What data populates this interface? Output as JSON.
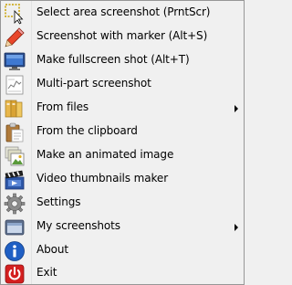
{
  "menu": {
    "items": [
      {
        "label": "Select area screenshot (PrntScr)",
        "icon": "select-area-icon",
        "submenu": false
      },
      {
        "label": "Screenshot with marker (Alt+S)",
        "icon": "pencil-icon",
        "submenu": false
      },
      {
        "label": "Make fullscreen shot (Alt+T)",
        "icon": "monitor-icon",
        "submenu": false
      },
      {
        "label": "Multi-part screenshot",
        "icon": "multi-part-icon",
        "submenu": false
      },
      {
        "label": "From files",
        "icon": "files-icon",
        "submenu": true
      },
      {
        "label": "From the clipboard",
        "icon": "clipboard-icon",
        "submenu": false
      },
      {
        "label": "Make an animated image",
        "icon": "animated-image-icon",
        "submenu": false
      },
      {
        "label": "Video thumbnails maker",
        "icon": "clapperboard-icon",
        "submenu": false
      },
      {
        "label": "Settings",
        "icon": "gear-icon",
        "submenu": false
      },
      {
        "label": "My screenshots",
        "icon": "screenshots-window-icon",
        "submenu": true
      },
      {
        "label": "About",
        "icon": "info-icon",
        "submenu": false
      },
      {
        "label": "Exit",
        "icon": "power-icon",
        "submenu": false
      }
    ]
  }
}
